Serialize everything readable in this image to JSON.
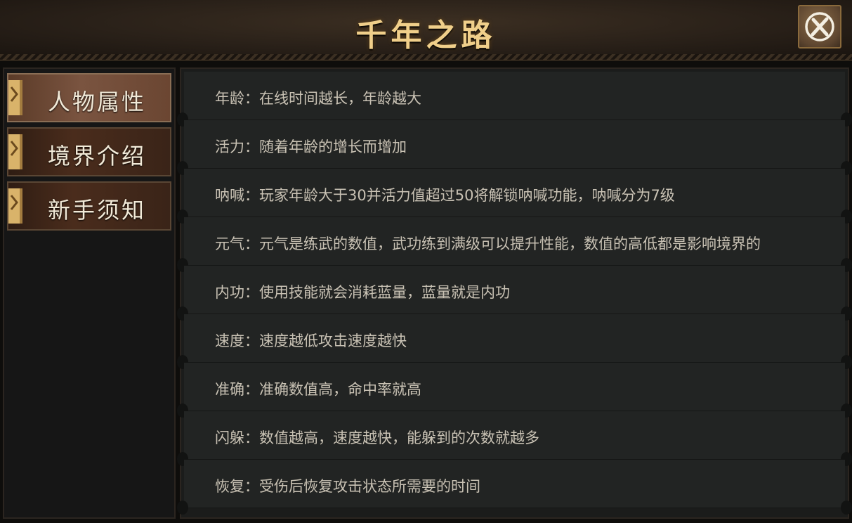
{
  "header": {
    "title": "千年之路"
  },
  "sidebar": {
    "items": [
      {
        "label": "人物属性",
        "active": true
      },
      {
        "label": "境界介绍",
        "active": false
      },
      {
        "label": "新手须知",
        "active": false
      }
    ]
  },
  "content": {
    "rows": [
      "年龄：在线时间越长，年龄越大",
      "活力：随着年龄的增长而增加",
      "呐喊：玩家年龄大于30并活力值超过50将解锁呐喊功能，呐喊分为7级",
      "元气：元气是练武的数值，武功练到满级可以提升性能，数值的高低都是影响境界的",
      "内功：使用技能就会消耗蓝量，蓝量就是内功",
      "速度：速度越低攻击速度越快",
      "准确：准确数值高，命中率就高",
      "闪躲：数值越高，速度越快，能躲到的次数就越多",
      "恢复：受伤后恢复攻击状态所需要的时间"
    ]
  },
  "icons": {
    "close": "close-icon",
    "tab_marker": "bookmark-marker-icon"
  },
  "colors": {
    "title": "#f0cf8a",
    "text": "#c9c2b4",
    "accent": "#c9a05a"
  }
}
